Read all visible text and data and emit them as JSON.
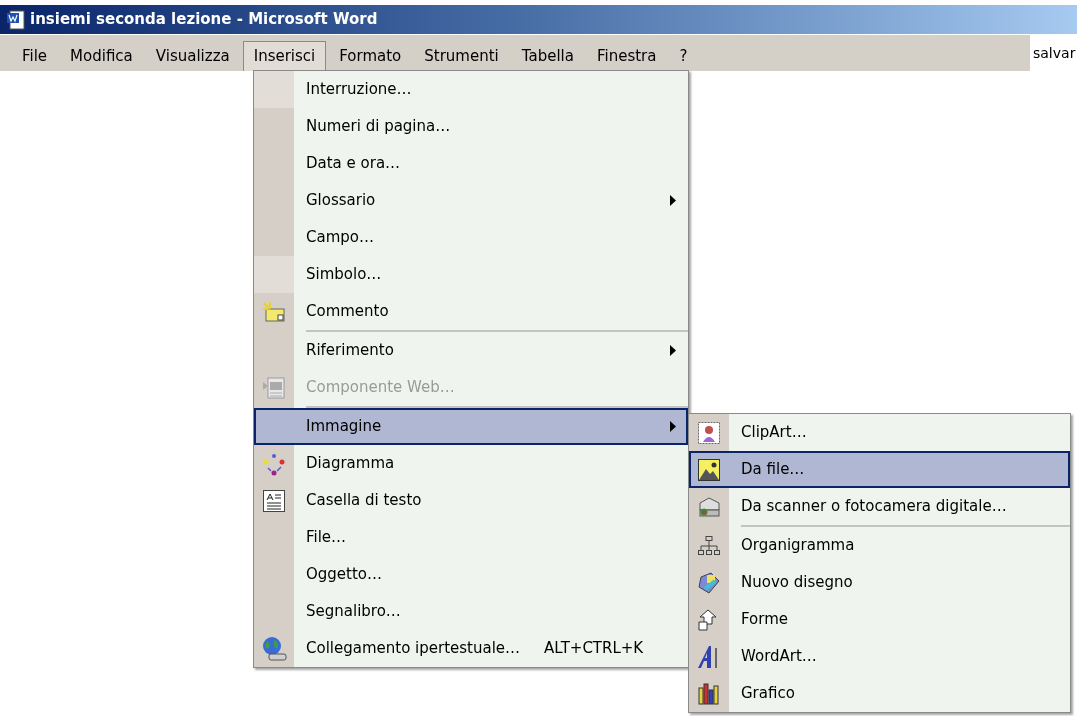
{
  "window": {
    "title": "insiemi seconda lezione - Microsoft Word"
  },
  "menu_bar": [
    {
      "label": "File",
      "selected": false
    },
    {
      "label": "Modifica",
      "selected": false
    },
    {
      "label": "Visualizza",
      "selected": false
    },
    {
      "label": "Inserisci",
      "selected": true
    },
    {
      "label": "Formato",
      "selected": false
    },
    {
      "label": "Strumenti",
      "selected": false
    },
    {
      "label": "Tabella",
      "selected": false
    },
    {
      "label": "Finestra",
      "selected": false
    },
    {
      "label": "?",
      "selected": false
    }
  ],
  "help_field": {
    "value": "salvar"
  },
  "insert_menu": [
    {
      "label": "Interruzione…",
      "rarely_used": true,
      "selected": false
    },
    {
      "label": "Numeri di pagina…",
      "rarely_used": false,
      "selected": false
    },
    {
      "label": "Data e ora…",
      "rarely_used": false,
      "selected": false
    },
    {
      "label": "Glossario",
      "rarely_used": false,
      "submenu": true,
      "selected": false
    },
    {
      "label": "Campo…",
      "rarely_used": false,
      "selected": false
    },
    {
      "label": "Simbolo…",
      "rarely_used": true,
      "selected": false
    },
    {
      "label": "Commento",
      "selected": false
    },
    {
      "label": "Riferimento",
      "separator_before": true,
      "submenu": true,
      "selected": false
    },
    {
      "label": "Componente Web…",
      "disabled": true,
      "selected": false
    },
    {
      "label": "Immagine",
      "separator_before": true,
      "submenu": true,
      "selected": true
    },
    {
      "label": "Diagramma",
      "selected": false
    },
    {
      "label": "Casella di testo",
      "selected": false
    },
    {
      "label": "File…",
      "selected": false
    },
    {
      "label": "Oggetto…",
      "selected": false
    },
    {
      "label": "Segnalibro…",
      "selected": false
    },
    {
      "label": "Collegamento ipertestuale…",
      "shortcut": "ALT+CTRL+K",
      "selected": false
    }
  ],
  "picture_submenu": [
    {
      "label": "ClipArt…",
      "selected": false
    },
    {
      "label": "Da file…",
      "selected": true
    },
    {
      "label": "Da scanner o fotocamera digitale…",
      "selected": false
    },
    {
      "label": "Organigramma",
      "separator_before": true,
      "selected": false
    },
    {
      "label": "Nuovo disegno",
      "selected": false
    },
    {
      "label": "Forme",
      "selected": false
    },
    {
      "label": "WordArt…",
      "selected": false
    },
    {
      "label": "Grafico",
      "selected": false
    }
  ]
}
